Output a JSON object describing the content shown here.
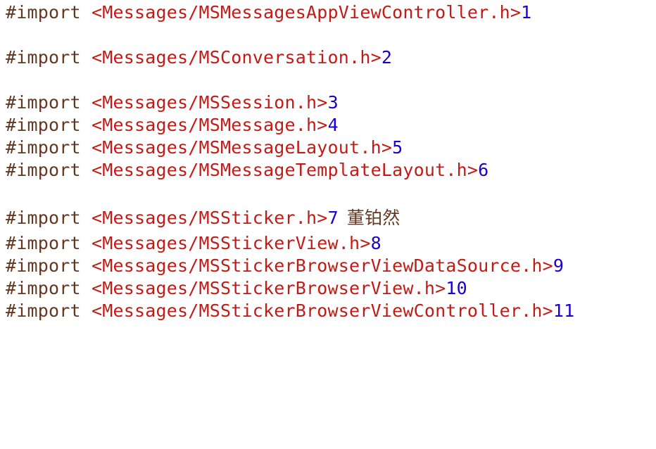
{
  "code_lines": [
    {
      "keyword": "#import",
      "path": "<Messages/MSMessagesAppViewController.h>",
      "line_number": "1",
      "note": ""
    },
    {
      "keyword": "#import",
      "path": "<Messages/MSConversation.h>",
      "line_number": "2",
      "note": ""
    },
    {
      "keyword": "#import",
      "path": "<Messages/MSSession.h>",
      "line_number": "3",
      "note": ""
    },
    {
      "keyword": "#import",
      "path": "<Messages/MSMessage.h>",
      "line_number": "4",
      "note": ""
    },
    {
      "keyword": "#import",
      "path": "<Messages/MSMessageLayout.h>",
      "line_number": "5",
      "note": ""
    },
    {
      "keyword": "#import",
      "path": "<Messages/MSMessageTemplateLayout.h>",
      "line_number": "6",
      "note": ""
    },
    {
      "keyword": "#import",
      "path": "<Messages/MSSticker.h>",
      "line_number": "7",
      "note": "董铂然"
    },
    {
      "keyword": "#import",
      "path": "<Messages/MSStickerView.h>",
      "line_number": "8",
      "note": ""
    },
    {
      "keyword": "#import",
      "path": "<Messages/MSStickerBrowserViewDataSource.h>",
      "line_number": "9",
      "note": ""
    },
    {
      "keyword": "#import",
      "path": "<Messages/MSStickerBrowserView.h>",
      "line_number": "10",
      "note": ""
    },
    {
      "keyword": "#import",
      "path": "<Messages/MSStickerBrowserViewController.h>",
      "line_number": "11",
      "note": ""
    }
  ]
}
